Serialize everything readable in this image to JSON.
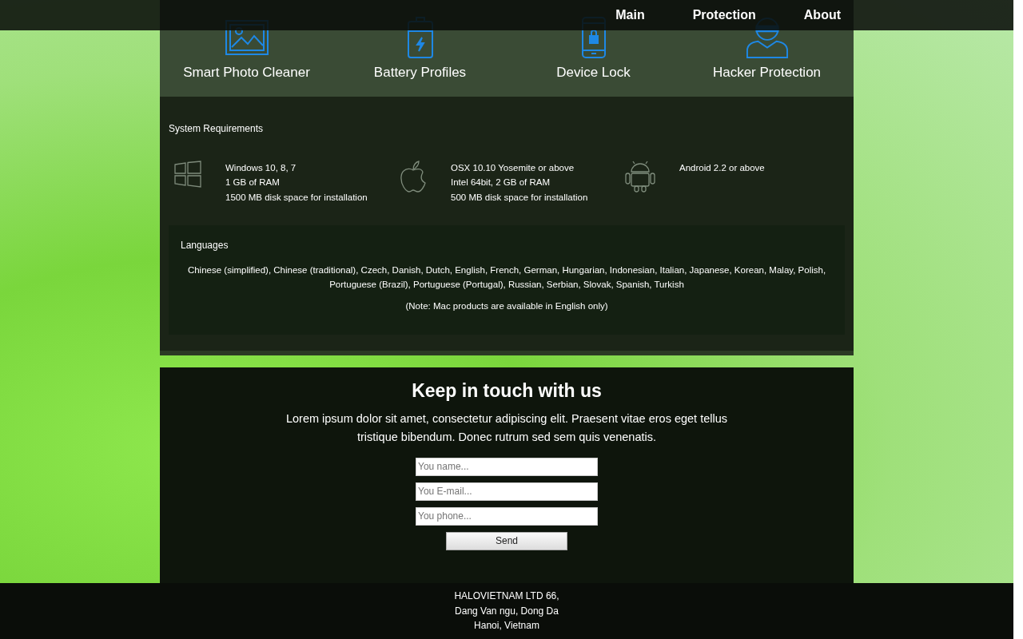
{
  "nav": [
    "Main",
    "Protection",
    "About"
  ],
  "features": {
    "items": [
      {
        "kind": "photo",
        "label": "Smart Photo Cleaner"
      },
      {
        "kind": "battery",
        "label": "Battery Profiles"
      },
      {
        "kind": "lock",
        "label": "Device Lock"
      },
      {
        "kind": "hacker",
        "label": "Hacker Protection"
      }
    ]
  },
  "requirements": {
    "title": "System Requirements",
    "platforms": [
      {
        "kind": "windows",
        "lines": [
          "Windows 10, 8, 7",
          "1 GB of RAM",
          "1500 MB disk space for installation"
        ]
      },
      {
        "kind": "apple",
        "lines": [
          "OSX 10.10 Yosemite or above",
          "Intel 64bit, 2 GB of RAM",
          "500 MB disk space for installation"
        ]
      },
      {
        "kind": "android",
        "lines": [
          "Android 2.2 or above"
        ]
      }
    ]
  },
  "languages": {
    "title": "Languages",
    "list": "Chinese (simplified), Chinese (traditional), Czech, Danish, Dutch, English, French, German, Hungarian, Indonesian, Italian, Japanese, Korean, Malay, Polish, Portuguese (Brazil), Portuguese (Portugal), Russian, Serbian, Slovak, Spanish, Turkish",
    "note": "(Note: Mac products are available in English only)"
  },
  "contact": {
    "title": "Keep in touch with us",
    "text": "Lorem ipsum dolor sit amet, consectetur adipiscing elit. Praesent vitae eros eget tellus tristique bibendum. Donec rutrum sed sem quis venenatis.",
    "fields": [
      {
        "placeholder": "You name..."
      },
      {
        "placeholder": "You E-mail..."
      },
      {
        "placeholder": "You phone..."
      }
    ],
    "button": "Send"
  },
  "footer": [
    "HALOVIETNAM LTD 66,",
    "Dang Van ngu, Dong Da",
    "Hanoi, Vietnam"
  ]
}
